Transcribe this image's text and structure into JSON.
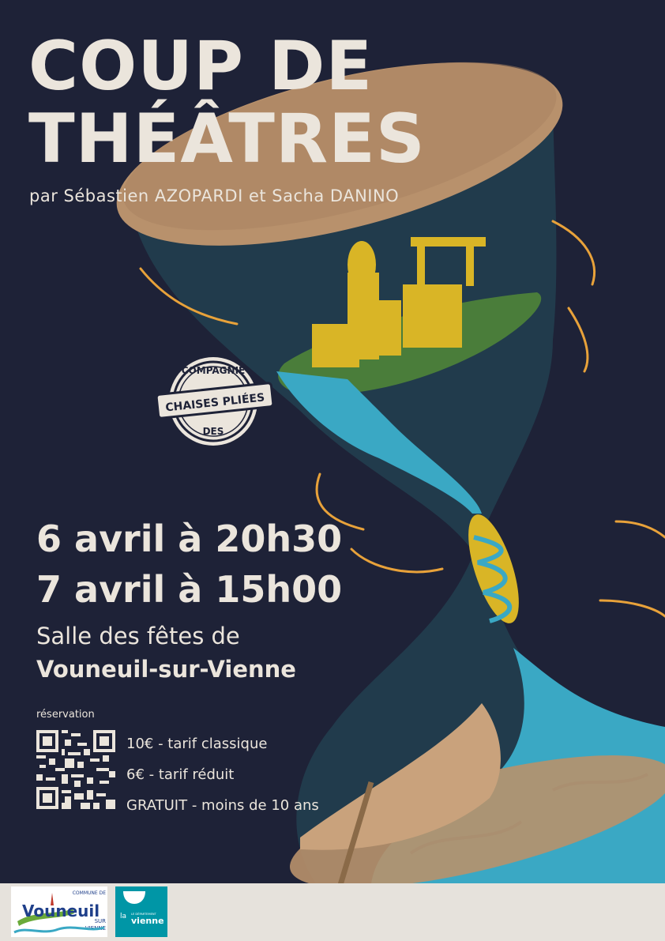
{
  "poster": {
    "title_line1": "COUP DE",
    "title_line2": "THÉÂTRES",
    "authors": "par Sébastien AZOPARDI et Sacha DANINO",
    "stamp": {
      "top": "COMPAGNIE",
      "middle": "CHAISES PLIÉES",
      "bottom": "DES"
    },
    "dates": [
      "6 avril à 20h30",
      "7 avril à 15h00"
    ],
    "venue_line1": "Salle des fêtes de",
    "venue_line2": "Vouneuil-sur-Vienne",
    "reservation_label": "réservation",
    "prices": [
      "10€ - tarif classique",
      "6€ - tarif réduit",
      "GRATUIT - moins de 10 ans"
    ]
  },
  "footer": {
    "vouneuil_logo": {
      "commune": "COMMUNE DE",
      "name": "Vouneuil",
      "sub1": "SUR",
      "sub2": "VIENNE"
    },
    "vienne_logo": {
      "la": "la",
      "dept": "LE DÉPARTEMENT",
      "name": "vienne"
    }
  },
  "colors": {
    "background": "#1e2237",
    "text": "#ebe5dc",
    "hourglass_cap": "#b8916c",
    "water": "#3aa8c4",
    "island": "#4a7d3a",
    "buildings": "#d9b526",
    "accent_lines": "#e8a23a",
    "footer": "#e6e2dc",
    "vienne_brand": "#0096a6"
  }
}
